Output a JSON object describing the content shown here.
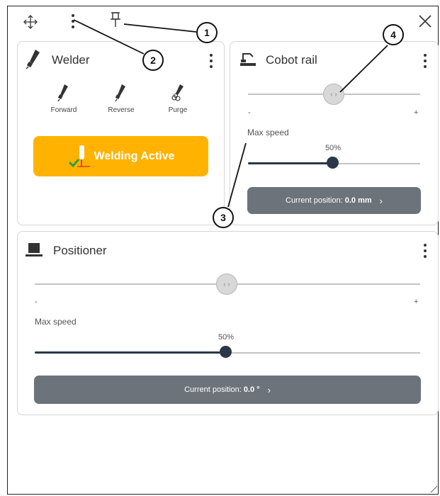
{
  "toolbar": {
    "move_icon": "move-icon",
    "menu_icon": "kebab-icon",
    "pin_icon": "pin-icon",
    "close_icon": "close-icon"
  },
  "callouts": [
    "1",
    "2",
    "3",
    "4"
  ],
  "welder": {
    "title": "Welder",
    "buttons": [
      "Forward",
      "Reverse",
      "Purge"
    ],
    "status_label": "Welding Active",
    "colors": {
      "status_bg": "#ffb300"
    }
  },
  "cobot_rail": {
    "title": "Cobot rail",
    "minus": "-",
    "plus": "+",
    "max_speed_label": "Max speed",
    "max_speed_value": "50%",
    "max_speed_fraction": 0.5,
    "position_prefix": "Current position:",
    "position_value": "0.0 mm",
    "position_chevron": "›"
  },
  "positioner": {
    "title": "Positioner",
    "minus": "-",
    "plus": "+",
    "max_speed_label": "Max speed",
    "max_speed_value": "50%",
    "max_speed_fraction": 0.5,
    "position_prefix": "Current position:",
    "position_value": "0.0 °",
    "position_chevron": "›"
  }
}
